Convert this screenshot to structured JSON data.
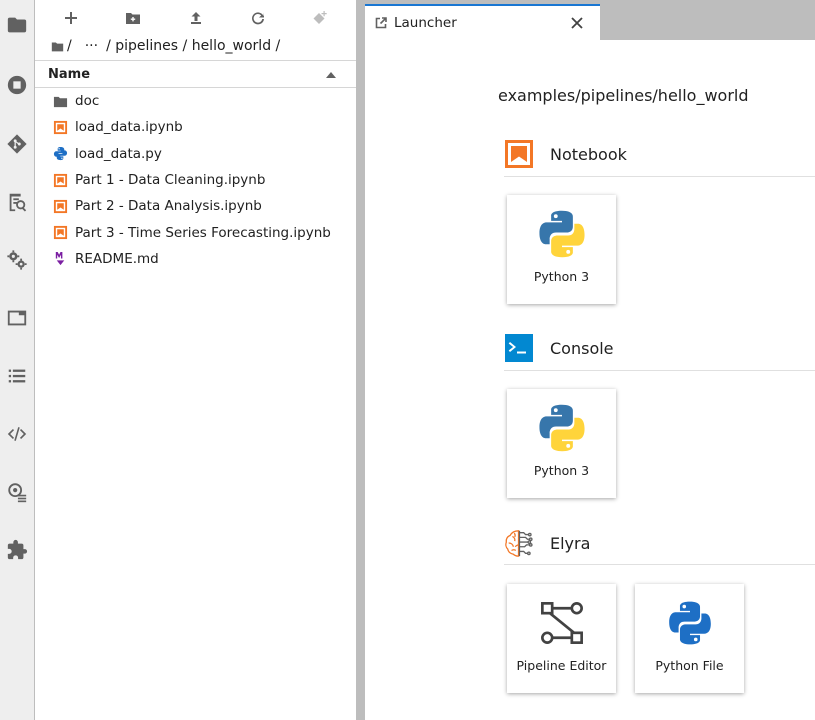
{
  "activity_bar": {
    "items": [
      {
        "name": "folder-icon"
      },
      {
        "name": "running-icon"
      },
      {
        "name": "git-icon"
      },
      {
        "name": "property-inspector-icon"
      },
      {
        "name": "settings-gears-icon"
      },
      {
        "name": "tabs-icon"
      },
      {
        "name": "table-of-contents-icon"
      },
      {
        "name": "code-snippets-icon"
      },
      {
        "name": "runtimes-icon"
      },
      {
        "name": "extensions-icon"
      }
    ]
  },
  "file_browser": {
    "breadcrumbs": {
      "separator": "/",
      "ellipsis": "···",
      "path": "/ pipelines / hello_world /"
    },
    "header": {
      "name_label": "Name"
    },
    "items": [
      {
        "label": "doc",
        "type": "folder"
      },
      {
        "label": "load_data.ipynb",
        "type": "notebook"
      },
      {
        "label": "load_data.py",
        "type": "python"
      },
      {
        "label": "Part 1 - Data Cleaning.ipynb",
        "type": "notebook"
      },
      {
        "label": "Part 2 - Data Analysis.ipynb",
        "type": "notebook"
      },
      {
        "label": "Part 3 - Time Series Forecasting.ipynb",
        "type": "notebook"
      },
      {
        "label": "README.md",
        "type": "markdown"
      }
    ]
  },
  "tabs": [
    {
      "label": "Launcher",
      "active": true
    }
  ],
  "launcher": {
    "path": "examples/pipelines/hello_world",
    "sections": {
      "notebook": {
        "title": "Notebook",
        "cards": [
          {
            "label": "Python 3"
          }
        ]
      },
      "console": {
        "title": "Console",
        "cards": [
          {
            "label": "Python 3"
          }
        ]
      },
      "elyra": {
        "title": "Elyra",
        "cards": [
          {
            "label": "Pipeline Editor"
          },
          {
            "label": "Python File"
          }
        ]
      }
    }
  },
  "colors": {
    "accent": "#1976d2",
    "notebook_orange": "#f37726",
    "console_blue": "#0288d1",
    "markdown_purple": "#7b1fa2",
    "python_blue": "#3776ab",
    "python_yellow": "#ffd43b"
  }
}
